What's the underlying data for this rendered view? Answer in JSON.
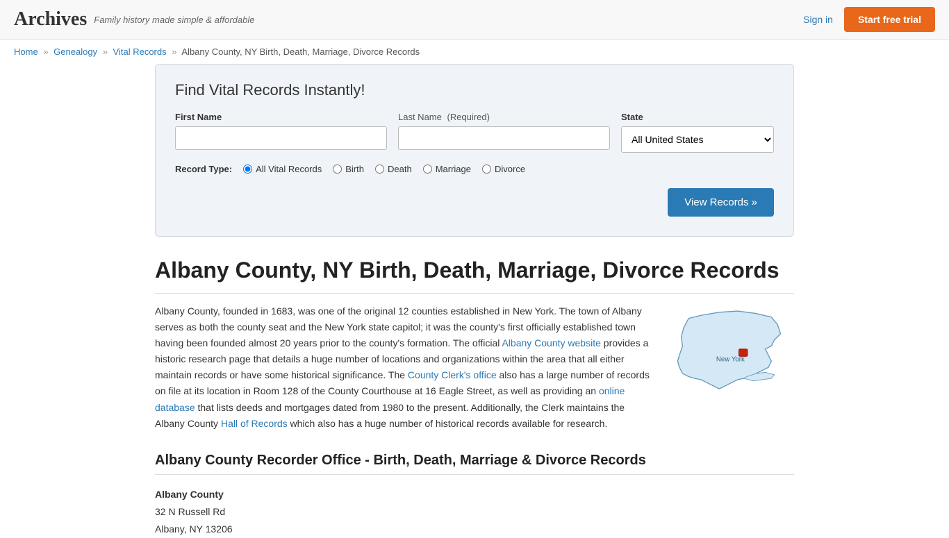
{
  "header": {
    "logo": "Archives",
    "tagline": "Family history made simple & affordable",
    "sign_in_label": "Sign in",
    "start_trial_label": "Start free trial"
  },
  "breadcrumb": {
    "home": "Home",
    "genealogy": "Genealogy",
    "vital_records": "Vital Records",
    "current": "Albany County, NY Birth, Death, Marriage, Divorce Records"
  },
  "search_box": {
    "title": "Find Vital Records Instantly!",
    "first_name_label": "First Name",
    "last_name_label": "Last Name",
    "last_name_required": "(Required)",
    "state_label": "State",
    "state_default": "All United States",
    "record_type_label": "Record Type:",
    "record_types": [
      {
        "id": "all",
        "label": "All Vital Records",
        "checked": true
      },
      {
        "id": "birth",
        "label": "Birth",
        "checked": false
      },
      {
        "id": "death",
        "label": "Death",
        "checked": false
      },
      {
        "id": "marriage",
        "label": "Marriage",
        "checked": false
      },
      {
        "id": "divorce",
        "label": "Divorce",
        "checked": false
      }
    ],
    "view_records_btn": "View Records »"
  },
  "page_title": "Albany County, NY Birth, Death, Marriage, Divorce Records",
  "description": {
    "text_parts": [
      "Albany County, founded in 1683, was one of the original 12 counties established in New York. The town of Albany serves as both the county seat and the New York state capitol; it was the county's first officially established town having been founded almost 20 years prior to the county's formation. The official ",
      " provides a historic research page that details a huge number of locations and organizations within the area that all either maintain records or have some historical significance. The ",
      " also has a large number of records on file at its location in Room 128 of the County Courthouse at 16 Eagle Street, as well as providing an ",
      " that lists deeds and mortgages dated from 1980 to the present. Additionally, the Clerk maintains the Albany County ",
      " which also has a huge number of historical records available for research."
    ],
    "links": [
      {
        "text": "Albany County website",
        "href": "#"
      },
      {
        "text": "County Clerk's office",
        "href": "#"
      },
      {
        "text": "online database",
        "href": "#"
      },
      {
        "text": "Hall of Records",
        "href": "#"
      }
    ]
  },
  "section_heading": "Albany County Recorder Office - Birth, Death, Marriage & Divorce Records",
  "office": {
    "name": "Albany County",
    "address1": "32 N Russell Rd",
    "address2": "Albany, NY 13206"
  }
}
